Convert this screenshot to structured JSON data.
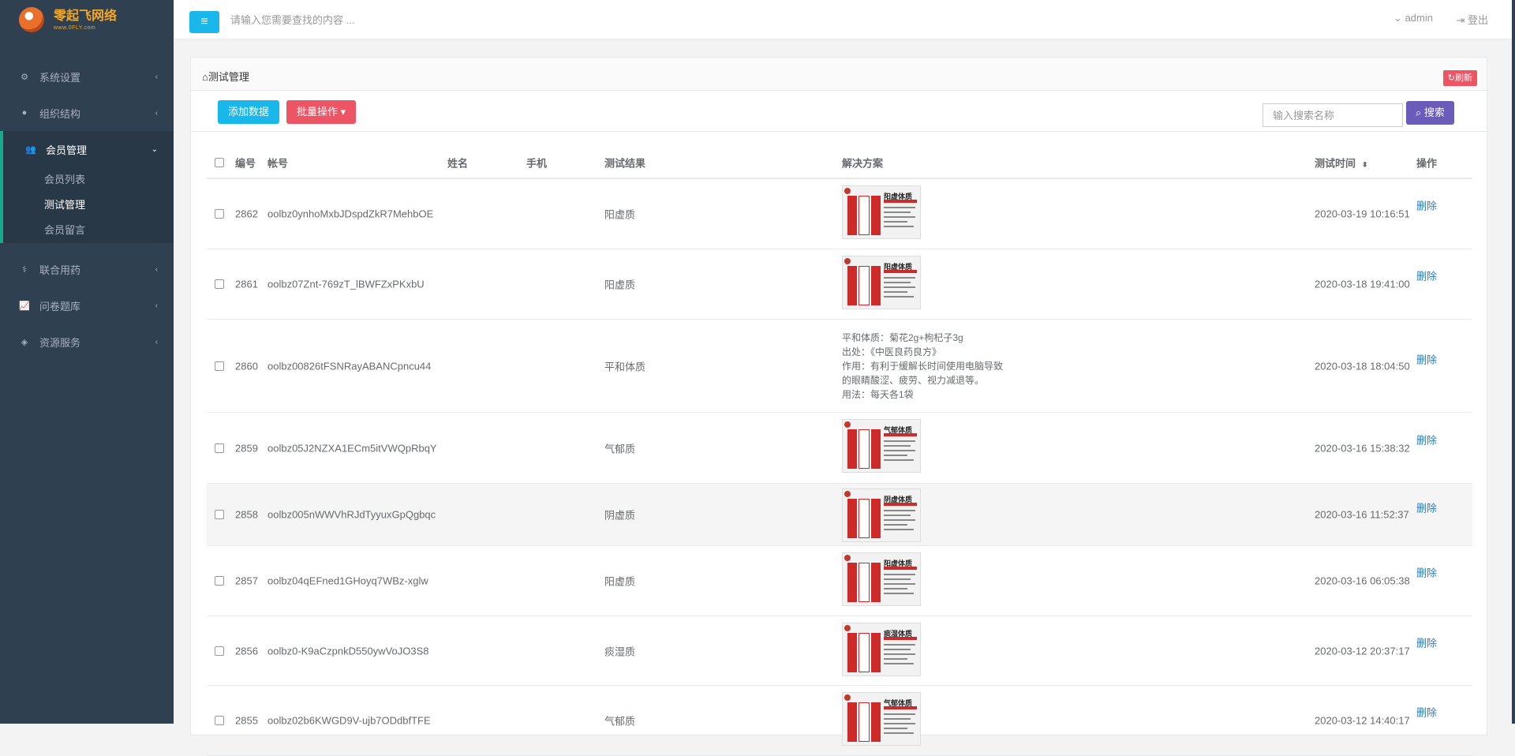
{
  "app": {
    "logo_brand": "零起飞网络",
    "logo_sub": "www.0FLY.com"
  },
  "topbar": {
    "search_placeholder": "请输入您需要查找的内容 ...",
    "user": "admin",
    "logout": "登出"
  },
  "sidebar": {
    "items": [
      {
        "label": "系统设置",
        "icon": "gears-icon"
      },
      {
        "label": "组织结构",
        "icon": "user-icon"
      },
      {
        "label": "会员管理",
        "icon": "users-icon"
      },
      {
        "label": "联合用药",
        "icon": "user-md-icon"
      },
      {
        "label": "问卷题库",
        "icon": "line-chart-icon"
      },
      {
        "label": "资源服务",
        "icon": "cube-icon"
      }
    ],
    "sub_items": [
      "会员列表",
      "测试管理",
      "会员留言"
    ]
  },
  "panel": {
    "title": "测试管理",
    "refresh": "刷新",
    "add_button": "添加数据",
    "batch_button": "批量操作",
    "search_placeholder": "输入搜索名称",
    "search_button": "搜索"
  },
  "table": {
    "columns": [
      "编号",
      "帐号",
      "姓名",
      "手机",
      "测试结果",
      "解决方案",
      "测试时间",
      "操作"
    ],
    "delete_label": "删除",
    "rows": [
      {
        "id": "2862",
        "account": "oolbz0ynhoMxbJDspdZkR7MehbOE",
        "result": "阳虚质",
        "poster_title": "阳虚体质",
        "time": "2020-03-19 10:16:51"
      },
      {
        "id": "2861",
        "account": "oolbz07Znt-769zT_lBWFZxPKxbU",
        "result": "阳虚质",
        "poster_title": "阳虚体质",
        "time": "2020-03-18 19:41:00"
      },
      {
        "id": "2860",
        "account": "oolbz00826tFSNRayABANCpncu44",
        "result": "平和体质",
        "solution_text": [
          "平和体质：菊花2g+枸杞子3g",
          "出处：《中医良药良方》",
          "作用：有利于缓解长时间使用电脑导致",
          "的眼睛酸涩、疲劳、视力减退等。",
          "用法：每天各1袋"
        ],
        "time": "2020-03-18 18:04:50"
      },
      {
        "id": "2859",
        "account": "oolbz05J2NZXA1ECm5itVWQpRbqY",
        "result": "气郁质",
        "poster_title": "气郁体质",
        "time": "2020-03-16 15:38:32"
      },
      {
        "id": "2858",
        "account": "oolbz005nWWVhRJdTyyuxGpQgbqc",
        "result": "阴虚质",
        "poster_title": "阴虚体质",
        "time": "2020-03-16 11:52:37"
      },
      {
        "id": "2857",
        "account": "oolbz04qEFned1GHoyq7WBz-xglw",
        "result": "阳虚质",
        "poster_title": "阳虚体质",
        "time": "2020-03-16 06:05:38"
      },
      {
        "id": "2856",
        "account": "oolbz0-K9aCzpnkD550ywVoJO3S8",
        "result": "痰湿质",
        "poster_title": "痰湿体质",
        "time": "2020-03-12 20:37:17"
      },
      {
        "id": "2855",
        "account": "oolbz02b6KWGD9V-ujb7ODdbfTFE",
        "result": "气郁质",
        "poster_title": "气郁体质",
        "time": "2020-03-12 14:40:17"
      }
    ]
  }
}
